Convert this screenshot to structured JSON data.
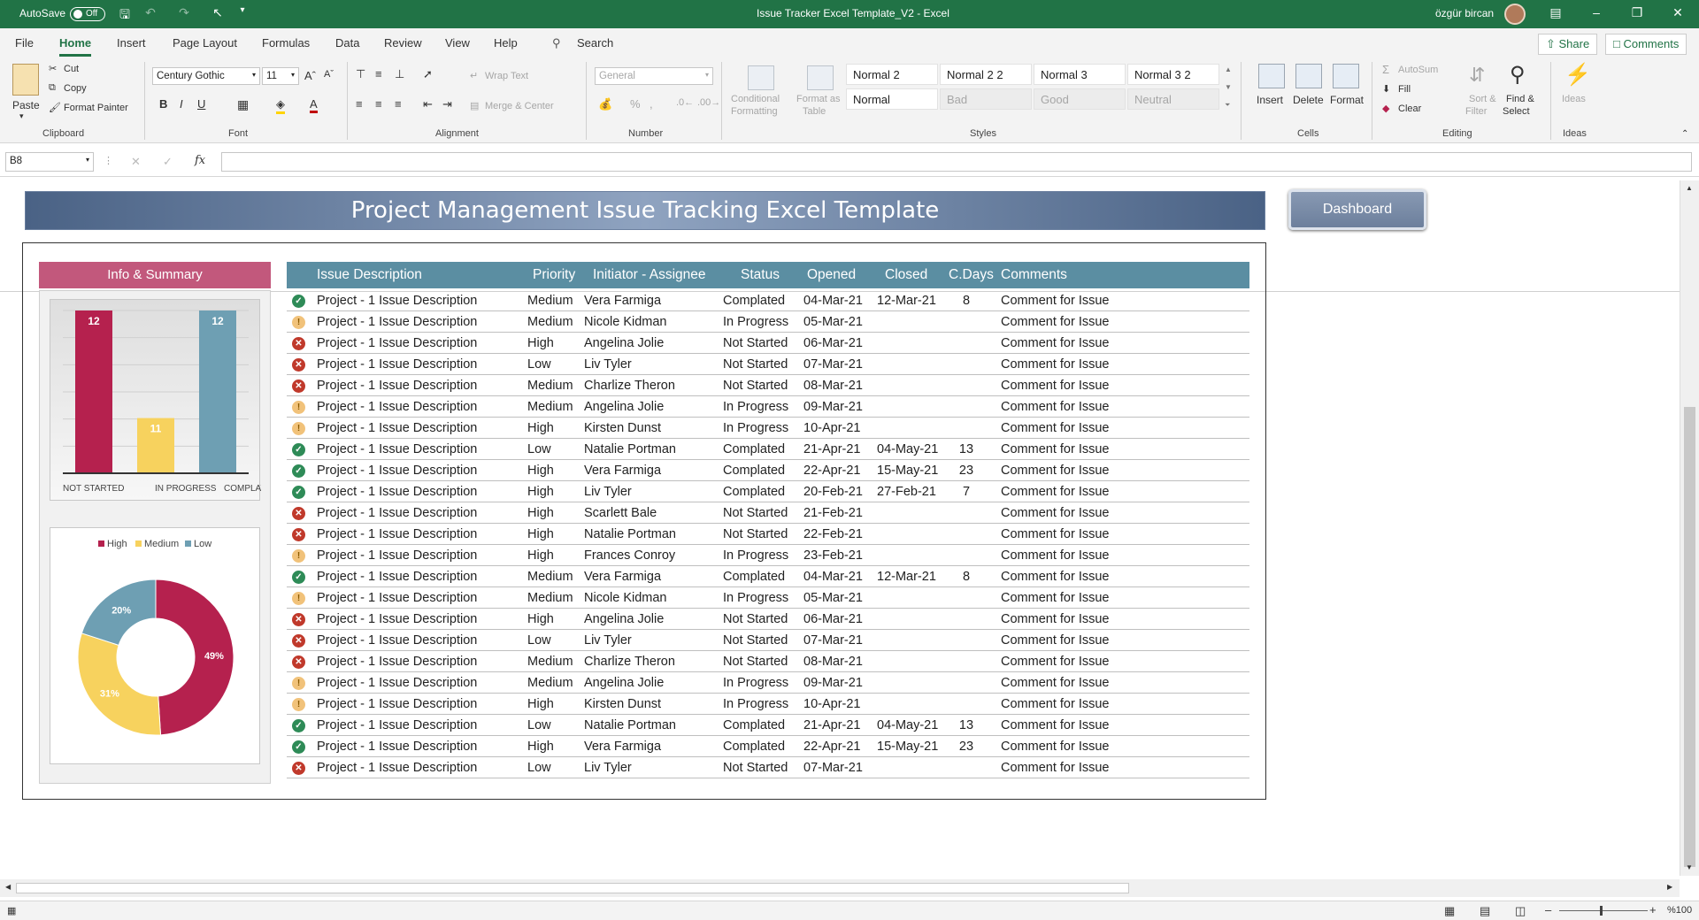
{
  "app": {
    "autosave_label": "AutoSave",
    "autosave_state": "Off",
    "title": "Issue Tracker Excel Template_V2  -  Excel",
    "user": "özgür bircan"
  },
  "menu": {
    "tabs": [
      "File",
      "Home",
      "Insert",
      "Page Layout",
      "Formulas",
      "Data",
      "Review",
      "View",
      "Help"
    ],
    "search": "Search",
    "share": "Share",
    "comments": "Comments"
  },
  "ribbon": {
    "clipboard": {
      "paste": "Paste",
      "cut": "Cut",
      "copy": "Copy",
      "format_painter": "Format Painter",
      "label": "Clipboard"
    },
    "font": {
      "name": "Century Gothic",
      "size": "11",
      "label": "Font"
    },
    "alignment": {
      "wrap": "Wrap Text",
      "merge": "Merge & Center",
      "label": "Alignment"
    },
    "number": {
      "format": "General",
      "label": "Number"
    },
    "styles": {
      "conditional": "Conditional",
      "formatting": "Formatting",
      "format_as": "Format as",
      "table": "Table",
      "cells": [
        "Normal 2",
        "Normal 2 2",
        "Normal 3",
        "Normal 3 2",
        "Normal",
        "Bad",
        "Good",
        "Neutral"
      ],
      "label": "Styles"
    },
    "cells": {
      "insert": "Insert",
      "delete": "Delete",
      "format": "Format",
      "label": "Cells"
    },
    "editing": {
      "autosum": "AutoSum",
      "fill": "Fill",
      "clear": "Clear",
      "sort": "Sort &",
      "filter": "Filter",
      "find": "Find &",
      "select": "Select",
      "label": "Editing"
    },
    "ideas": {
      "button": "Ideas",
      "label": "Ideas"
    }
  },
  "formula_bar": {
    "name_box": "B8",
    "fx": "fx",
    "content": ""
  },
  "sheet": {
    "banner": "Project Management Issue Tracking Excel Template",
    "dashboard": "Dashboard",
    "info_summary": "Info & Summary",
    "columns": [
      "Issue Description",
      "Priority",
      "Initiator - Assignee",
      "Status",
      "Opened",
      "Closed",
      "C.Days",
      "Comments"
    ],
    "rows": [
      {
        "icon": "ok",
        "desc": "Project - 1 Issue Description",
        "priority": "Medium",
        "person": "Vera Farmiga",
        "status": "Complated",
        "opened": "04-Mar-21",
        "closed": "12-Mar-21",
        "days": "8",
        "comment": "Comment for Issue"
      },
      {
        "icon": "warn",
        "desc": "Project - 1 Issue Description",
        "priority": "Medium",
        "person": "Nicole Kidman",
        "status": "In Progress",
        "opened": "05-Mar-21",
        "closed": "",
        "days": "",
        "comment": "Comment for Issue"
      },
      {
        "icon": "bad",
        "desc": "Project - 1 Issue Description",
        "priority": "High",
        "person": "Angelina Jolie",
        "status": "Not Started",
        "opened": "06-Mar-21",
        "closed": "",
        "days": "",
        "comment": "Comment for Issue"
      },
      {
        "icon": "bad",
        "desc": "Project - 1 Issue Description",
        "priority": "Low",
        "person": "Liv Tyler",
        "status": "Not Started",
        "opened": "07-Mar-21",
        "closed": "",
        "days": "",
        "comment": "Comment for Issue"
      },
      {
        "icon": "bad",
        "desc": "Project - 1 Issue Description",
        "priority": "Medium",
        "person": "Charlize Theron",
        "status": "Not Started",
        "opened": "08-Mar-21",
        "closed": "",
        "days": "",
        "comment": "Comment for Issue"
      },
      {
        "icon": "warn",
        "desc": "Project - 1 Issue Description",
        "priority": "Medium",
        "person": "Angelina Jolie",
        "status": "In Progress",
        "opened": "09-Mar-21",
        "closed": "",
        "days": "",
        "comment": "Comment for Issue"
      },
      {
        "icon": "warn",
        "desc": "Project - 1 Issue Description",
        "priority": "High",
        "person": "Kirsten Dunst",
        "status": "In Progress",
        "opened": "10-Apr-21",
        "closed": "",
        "days": "",
        "comment": "Comment for Issue"
      },
      {
        "icon": "ok",
        "desc": "Project - 1 Issue Description",
        "priority": "Low",
        "person": "Natalie Portman",
        "status": "Complated",
        "opened": "21-Apr-21",
        "closed": "04-May-21",
        "days": "13",
        "comment": "Comment for Issue"
      },
      {
        "icon": "ok",
        "desc": "Project - 1 Issue Description",
        "priority": "High",
        "person": "Vera Farmiga",
        "status": "Complated",
        "opened": "22-Apr-21",
        "closed": "15-May-21",
        "days": "23",
        "comment": "Comment for Issue"
      },
      {
        "icon": "ok",
        "desc": "Project - 1 Issue Description",
        "priority": "High",
        "person": "Liv Tyler",
        "status": "Complated",
        "opened": "20-Feb-21",
        "closed": "27-Feb-21",
        "days": "7",
        "comment": "Comment for Issue"
      },
      {
        "icon": "bad",
        "desc": "Project - 1 Issue Description",
        "priority": "High",
        "person": "Scarlett Bale",
        "status": "Not Started",
        "opened": "21-Feb-21",
        "closed": "",
        "days": "",
        "comment": "Comment for Issue"
      },
      {
        "icon": "bad",
        "desc": "Project - 1 Issue Description",
        "priority": "High",
        "person": "Natalie Portman",
        "status": "Not Started",
        "opened": "22-Feb-21",
        "closed": "",
        "days": "",
        "comment": "Comment for Issue"
      },
      {
        "icon": "warn",
        "desc": "Project - 1 Issue Description",
        "priority": "High",
        "person": "Frances Conroy",
        "status": "In Progress",
        "opened": "23-Feb-21",
        "closed": "",
        "days": "",
        "comment": "Comment for Issue"
      },
      {
        "icon": "ok",
        "desc": "Project - 1 Issue Description",
        "priority": "Medium",
        "person": "Vera Farmiga",
        "status": "Complated",
        "opened": "04-Mar-21",
        "closed": "12-Mar-21",
        "days": "8",
        "comment": "Comment for Issue"
      },
      {
        "icon": "warn",
        "desc": "Project - 1 Issue Description",
        "priority": "Medium",
        "person": "Nicole Kidman",
        "status": "In Progress",
        "opened": "05-Mar-21",
        "closed": "",
        "days": "",
        "comment": "Comment for Issue"
      },
      {
        "icon": "bad",
        "desc": "Project - 1 Issue Description",
        "priority": "High",
        "person": "Angelina Jolie",
        "status": "Not Started",
        "opened": "06-Mar-21",
        "closed": "",
        "days": "",
        "comment": "Comment for Issue"
      },
      {
        "icon": "bad",
        "desc": "Project - 1 Issue Description",
        "priority": "Low",
        "person": "Liv Tyler",
        "status": "Not Started",
        "opened": "07-Mar-21",
        "closed": "",
        "days": "",
        "comment": "Comment for Issue"
      },
      {
        "icon": "bad",
        "desc": "Project - 1 Issue Description",
        "priority": "Medium",
        "person": "Charlize Theron",
        "status": "Not Started",
        "opened": "08-Mar-21",
        "closed": "",
        "days": "",
        "comment": "Comment for Issue"
      },
      {
        "icon": "warn",
        "desc": "Project - 1 Issue Description",
        "priority": "Medium",
        "person": "Angelina Jolie",
        "status": "In Progress",
        "opened": "09-Mar-21",
        "closed": "",
        "days": "",
        "comment": "Comment for Issue"
      },
      {
        "icon": "warn",
        "desc": "Project - 1 Issue Description",
        "priority": "High",
        "person": "Kirsten Dunst",
        "status": "In Progress",
        "opened": "10-Apr-21",
        "closed": "",
        "days": "",
        "comment": "Comment for Issue"
      },
      {
        "icon": "ok",
        "desc": "Project - 1 Issue Description",
        "priority": "Low",
        "person": "Natalie Portman",
        "status": "Complated",
        "opened": "21-Apr-21",
        "closed": "04-May-21",
        "days": "13",
        "comment": "Comment for Issue"
      },
      {
        "icon": "ok",
        "desc": "Project - 1 Issue Description",
        "priority": "High",
        "person": "Vera Farmiga",
        "status": "Complated",
        "opened": "22-Apr-21",
        "closed": "15-May-21",
        "days": "23",
        "comment": "Comment for Issue"
      },
      {
        "icon": "bad",
        "desc": "Project - 1 Issue Description",
        "priority": "Low",
        "person": "Liv Tyler",
        "status": "Not Started",
        "opened": "07-Mar-21",
        "closed": "",
        "days": "",
        "comment": "Comment for Issue"
      }
    ]
  },
  "colors": {
    "excel_green": "#217346",
    "bar_not_started": "#b5214e",
    "bar_in_progress": "#f7d25e",
    "bar_completed": "#6e9fb3",
    "pie_high": "#b5214e",
    "pie_medium": "#f7d25e",
    "pie_low": "#6e9fb3"
  },
  "chart_data": [
    {
      "type": "bar",
      "categories": [
        "NOT STARTED",
        "IN PROGRESS",
        "COMPLATED"
      ],
      "values": [
        12,
        11,
        12
      ],
      "data_labels": [
        "12",
        "11",
        "12"
      ],
      "ylim": [
        0,
        12
      ]
    },
    {
      "type": "pie",
      "donut": true,
      "labels": [
        "High",
        "Medium",
        "Low"
      ],
      "values": [
        49,
        31,
        20
      ],
      "data_labels": [
        "49%",
        "31%",
        "20%"
      ],
      "legend": "top"
    }
  ],
  "status_bar": {
    "zoom": "%100"
  }
}
